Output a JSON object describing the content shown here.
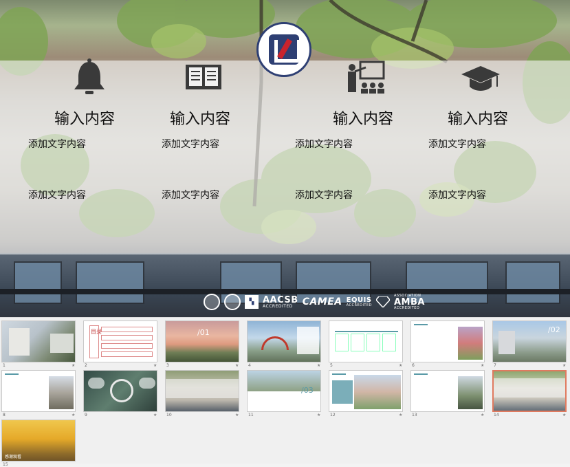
{
  "slide": {
    "columns": [
      {
        "icon": "bell-icon",
        "title": "输入内容",
        "text1": "添加文字内容",
        "text2": "添加文字内容"
      },
      {
        "icon": "book-icon",
        "title": "输入内容",
        "text1": "添加文字内容",
        "text2": "添加文字内容"
      },
      {
        "icon": "teacher-icon",
        "title": "输入内容",
        "text1": "添加文字内容",
        "text2": "添加文字内容"
      },
      {
        "icon": "graduation-cap-icon",
        "title": "输入内容",
        "text1": "添加文字内容",
        "text2": "添加文字内容"
      }
    ],
    "accreditations": [
      "AACSB",
      "CAMEA",
      "EQUIS",
      "AMBA"
    ],
    "accreditation_sub": {
      "aacsb": "ACCREDITED",
      "equis": "ACCREDITED",
      "amba": "ACCREDITED",
      "amba_top": "ASSOCIATION"
    }
  },
  "thumbnails": {
    "numbers": [
      "1",
      "2",
      "3",
      "4",
      "5",
      "6",
      "7",
      "8",
      "9",
      "10",
      "11",
      "12",
      "13",
      "14",
      "15"
    ],
    "slide2_title": "目录",
    "slide3_label": "/01",
    "slide7_label": "/02",
    "slide11_label": "/03",
    "slide15_caption": "感谢观看",
    "selected": "14"
  },
  "colors": {
    "panel": "#f5f5f5",
    "accent_teal": "#5a9aa7",
    "selected_border": "#e07a5f",
    "logo_blue": "#2e3f73",
    "logo_red": "#c8232c"
  }
}
